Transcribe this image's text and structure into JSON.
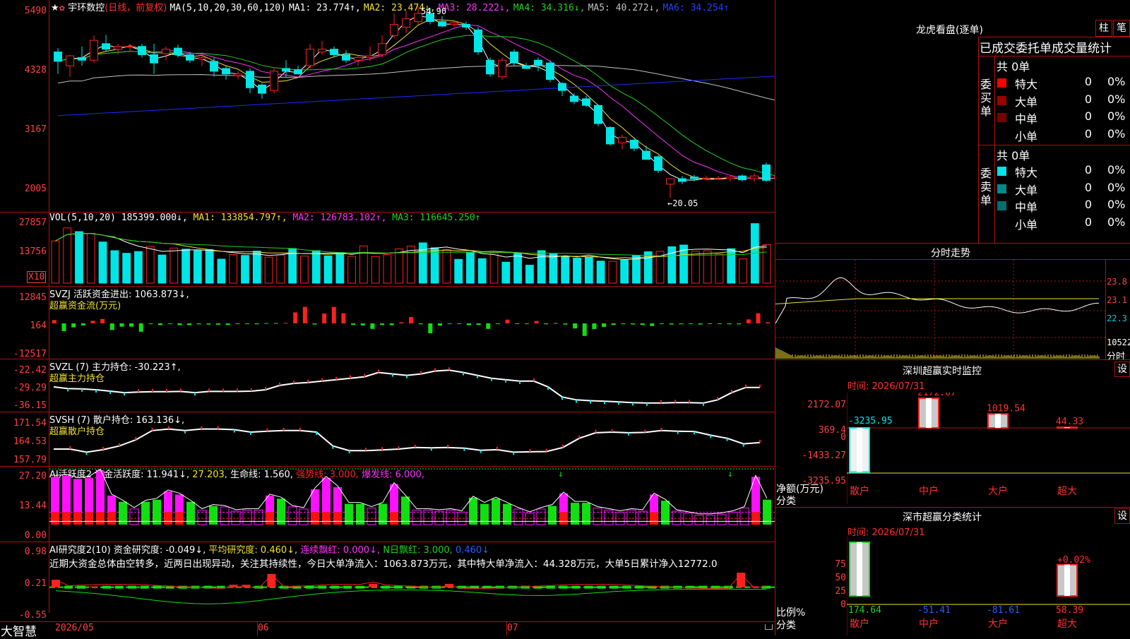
{
  "colors": {
    "up": "#ff2020",
    "down": "#00e5e5",
    "grid": "#b01010",
    "axis": "#ff4040",
    "ma1": "#ffffff",
    "ma2": "#f0e030",
    "ma3": "#ff30ff",
    "ma4": "#20d020",
    "ma5": "#c0c0c0",
    "ma6": "#1a2cff",
    "green": "#10e010",
    "magenta": "#ff10ff"
  },
  "main": {
    "title": "宇环数控",
    "period": "(日线，前复权)",
    "ma_params": "MA(5,10,20,30,60,120)",
    "ma1": "MA1: 23.774↑,",
    "ma2": "MA2: 23.474↓,",
    "ma3": "MA3: 28.222↓,",
    "ma4": "MA4: 34.316↓,",
    "ma5": "MA5: 40.272↓,",
    "ma6": "MA6: 34.254↑",
    "axis": [
      "5490",
      "4328",
      "3167",
      "2005"
    ],
    "high_label": "54.90",
    "low_label": "←20.05"
  },
  "vol": {
    "header": "VOL(5,10,20)",
    "v": "185399.000↓,",
    "ma1": "MA1: 133854.797↑,",
    "ma2": "MA2: 126783.102↑,",
    "ma3": "MA3: 116645.250↑",
    "axis": [
      "27857",
      "13756"
    ],
    "unit": "X10"
  },
  "svzj": {
    "header": "SVZJ  活跃资金进出: 1063.873↓,",
    "sub": "超赢资金流(万元)",
    "axis": [
      "12845",
      "164",
      "-12517"
    ]
  },
  "svzl": {
    "header": "SVZL (7) 主力持仓: -30.223↑,",
    "sub": "超赢主力持仓",
    "axis": [
      "-22.42",
      "-29.29",
      "-36.15"
    ]
  },
  "svsh": {
    "header": "SVSH (7) 散户持仓: 163.136↓,",
    "sub": "超赢散户持仓",
    "axis": [
      "171.54",
      "164.53",
      "157.79"
    ]
  },
  "ai1": {
    "header_a": "AI活跃度2 资金活跃度: 11.941↓,",
    "header_b": "27.203,",
    "header_c": "生命线: 1.560,",
    "header_d": "强势线: 3.000,",
    "header_e": "爆发线: 6.000,",
    "axis": [
      "27.20",
      "13.44",
      "0.00"
    ]
  },
  "ai2": {
    "header_a": "AI研究度2(10) 资金研究度: -0.049↓,",
    "header_b": "平均研究度: 0.460↓,",
    "header_c": "连续飘红: 0.000↓,",
    "header_d": "N日飘红: 3.000,",
    "header_e": "0.460↓",
    "text": "近期大资金总体由空转多，近两日出现异动，关注其持续性，今日大单净流入：1063.873万元，其中特大单净流入：44.328万元，大单5日累计净入12772.0",
    "axis": [
      "0.98",
      "0.21",
      "-0.55"
    ]
  },
  "xaxis": {
    "brand": "大智慧",
    "d1": "2026/05",
    "d2": "06",
    "d3": "07"
  },
  "right": {
    "lhb_title": "龙虎看盘(逐单)",
    "btn_zhu": "柱",
    "btn_bi": "笔",
    "tabs": "已成交委托单成交量统计",
    "buy_label": "委买单",
    "sell_label": "委卖单",
    "buy_total": "共 0单",
    "sell_total": "共 0单",
    "rows": [
      {
        "name": "特大",
        "val": "0",
        "pct": "0%"
      },
      {
        "name": "大单",
        "val": "0",
        "pct": "0%"
      },
      {
        "name": "中单",
        "val": "0",
        "pct": "0%"
      },
      {
        "name": "小单",
        "val": "0",
        "pct": "0%"
      }
    ],
    "fs_title": "分时走势",
    "fs_axis": [
      "23.8",
      "23.1",
      "22.3",
      "10522"
    ],
    "fs_unit": "分时",
    "sz_title": "深圳超赢实时监控",
    "sz_btn": "设",
    "sz_time": "时间: 2026/07/31",
    "sz_axis": [
      "2172.07",
      "369.4",
      "0",
      "-1433.27",
      "-3235.95"
    ],
    "sz_ylabel": "净额(万元)",
    "sz_xlabel": "分类",
    "sz_cats": [
      "散户",
      "中户",
      "大户",
      "超大"
    ],
    "sz_values": [
      "-3235.95",
      "2172.07",
      "1019.54",
      "44.33"
    ],
    "ss_title": "深市超赢分类统计",
    "ss_btn": "设",
    "ss_time": "时间: 2026/07/31",
    "ss_axis": [
      "75",
      "50",
      "25",
      "0"
    ],
    "ss_ylabel": "比例%",
    "ss_xlabel": "分类",
    "ss_cats": [
      "散户",
      "中户",
      "大户",
      "超大"
    ],
    "ss_values": [
      "174.64",
      "-51.41",
      "-81.61",
      "58.39"
    ],
    "ss_pct": "+0.02%"
  },
  "chart_data": [
    {
      "type": "candlestick",
      "title": "宇环数控 (日线，前复权)",
      "ylim": [
        20.05,
        54.9
      ],
      "candles": [
        [
          46.5,
          47.2,
          42.5,
          44.8
        ],
        [
          44.0,
          46.0,
          42.0,
          45.8
        ],
        [
          45.5,
          47.5,
          44.0,
          45.0
        ],
        [
          45.0,
          49.5,
          44.5,
          48.6
        ],
        [
          48.0,
          49.6,
          46.5,
          47.0
        ],
        [
          47.0,
          48.0,
          46.0,
          47.5
        ],
        [
          47.5,
          48.0,
          46.5,
          47.5
        ],
        [
          47.5,
          48.0,
          45.5,
          46.0
        ],
        [
          46.0,
          48.0,
          42.5,
          44.5
        ],
        [
          46.2,
          47.5,
          45.0,
          47.0
        ],
        [
          47.2,
          47.8,
          45.5,
          46.0
        ],
        [
          46.0,
          46.5,
          44.5,
          45.0
        ],
        [
          45.2,
          46.0,
          44.0,
          45.5
        ],
        [
          44.8,
          45.5,
          42.0,
          43.0
        ],
        [
          43.5,
          44.0,
          41.5,
          42.5
        ],
        [
          42.2,
          43.0,
          41.5,
          42.5
        ],
        [
          43.0,
          43.5,
          39.0,
          40.0
        ],
        [
          40.5,
          40.8,
          38.0,
          39.0
        ],
        [
          39.5,
          43.5,
          39.0,
          43.0
        ],
        [
          43.5,
          45.0,
          41.8,
          43.0
        ],
        [
          43.3,
          44.0,
          42.5,
          42.5
        ],
        [
          44.0,
          48.0,
          43.5,
          47.0
        ],
        [
          46.5,
          48.5,
          46.0,
          47.0
        ],
        [
          47.0,
          47.5,
          45.5,
          46.0
        ],
        [
          46.0,
          46.8,
          44.5,
          45.0
        ],
        [
          45.0,
          45.8,
          44.0,
          45.5
        ],
        [
          45.5,
          47.5,
          44.8,
          45.8
        ],
        [
          46.0,
          49.5,
          45.5,
          48.0
        ],
        [
          49.5,
          53.5,
          49.0,
          51.5
        ],
        [
          51.0,
          54.0,
          50.0,
          52.5
        ],
        [
          52.0,
          54.9,
          51.5,
          53.5
        ],
        [
          53.5,
          54.5,
          51.5,
          52.0
        ],
        [
          52.0,
          53.0,
          51.0,
          51.2
        ],
        [
          51.5,
          52.0,
          51.0,
          51.8
        ],
        [
          51.5,
          52.0,
          50.5,
          51.0
        ],
        [
          50.5,
          51.0,
          46.0,
          46.5
        ],
        [
          45.0,
          45.5,
          42.0,
          42.5
        ],
        [
          42.0,
          45.5,
          41.5,
          45.0
        ],
        [
          46.5,
          47.0,
          44.0,
          44.5
        ],
        [
          44.0,
          44.5,
          43.5,
          43.5
        ],
        [
          45.0,
          45.5,
          43.0,
          44.0
        ],
        [
          44.5,
          45.0,
          41.0,
          41.5
        ],
        [
          40.8,
          41.0,
          38.5,
          39.5
        ],
        [
          38.5,
          39.0,
          37.0,
          37.5
        ],
        [
          38.0,
          38.5,
          36.5,
          36.8
        ],
        [
          36.8,
          37.0,
          33.0,
          33.5
        ],
        [
          32.8,
          33.0,
          29.5,
          29.8
        ],
        [
          30.0,
          31.5,
          28.8,
          31.0
        ],
        [
          30.5,
          31.0,
          28.5,
          29.0
        ],
        [
          28.5,
          29.5,
          27.0,
          27.0
        ],
        [
          27.5,
          27.8,
          24.5,
          25.0
        ],
        [
          22.5,
          23.5,
          20.05,
          23.5
        ],
        [
          23.5,
          24.0,
          22.5,
          23.0
        ],
        [
          23.8,
          24.2,
          23.0,
          23.5
        ],
        [
          23.5,
          24.0,
          23.2,
          23.6
        ],
        [
          23.5,
          24.0,
          23.3,
          23.5
        ],
        [
          23.5,
          24.0,
          23.0,
          23.8
        ],
        [
          24.0,
          24.3,
          23.0,
          23.3
        ],
        [
          23.5,
          24.5,
          23.0,
          24.0
        ],
        [
          26.0,
          26.4,
          23.0,
          23.2
        ],
        [
          23.8,
          24.2,
          23.5,
          23.9
        ]
      ]
    },
    {
      "type": "bar",
      "title": "VOL(5,10,20)",
      "values": [
        19500,
        25500,
        23800,
        23000,
        19000,
        15000,
        13800,
        14600,
        17000,
        13000,
        16200,
        15700,
        15000,
        15500,
        11100,
        13200,
        12800,
        14800,
        12000,
        13000,
        16000,
        12500,
        15000,
        12600,
        14000,
        12400,
        17200,
        12300,
        13200,
        15800,
        17100,
        18600,
        16300,
        15500,
        11000,
        14200,
        11300,
        14000,
        9700,
        13900,
        8300,
        15000,
        13600,
        12300,
        11600,
        12200,
        10200,
        10100,
        10600,
        12800,
        14500,
        14700,
        16800,
        17600,
        14700,
        14900,
        13500,
        15900,
        11200,
        27500,
        17800
      ],
      "up": [
        1,
        1,
        0,
        1,
        0,
        0,
        0,
        0,
        1,
        0,
        1,
        0,
        0,
        0,
        0,
        1,
        0,
        0,
        1,
        1,
        0,
        1,
        0,
        0,
        0,
        1,
        1,
        1,
        1,
        1,
        1,
        0,
        0,
        1,
        0,
        0,
        0,
        1,
        0,
        0,
        0,
        0,
        0,
        0,
        0,
        0,
        0,
        1,
        0,
        0,
        0,
        1,
        0,
        0,
        1,
        1,
        1,
        0,
        1,
        0,
        1
      ]
    },
    {
      "type": "bar",
      "title": "超赢资金流(万元)",
      "values": [
        1500,
        -3500,
        -1800,
        -900,
        1200,
        2000,
        -3000,
        -1500,
        -1500,
        -3800,
        -200,
        -800,
        -300,
        -800,
        -800,
        -400,
        -500,
        -600,
        -700,
        -300,
        -200,
        -400,
        0,
        0,
        200,
        5000,
        7500,
        -500,
        4500,
        7500,
        4600,
        -700,
        -900,
        -2500,
        -700,
        -800,
        500,
        2900,
        -400,
        -4500,
        -1000,
        -200,
        -300,
        -800,
        -700,
        -2500,
        -300,
        1700,
        -200,
        -300,
        1100,
        -400,
        0,
        -500,
        -2300,
        -5700,
        -2600,
        -1600,
        -700,
        -200,
        -500,
        -700,
        -1200,
        -300,
        -500,
        -400,
        -200,
        -500,
        -200,
        -300,
        -400,
        -400,
        1800,
        4600,
        500
      ]
    },
    {
      "type": "line",
      "title": "超赢主力持仓",
      "values": [
        -30.0,
        -30.6,
        -30.7,
        -31.0,
        -31.5,
        -32.0,
        -31.8,
        -31.7,
        -31.7,
        -31.6,
        -32.0,
        -31.6,
        -31.6,
        -31.6,
        -31.5,
        -31.0,
        -29.5,
        -28.8,
        -28.5,
        -28.0,
        -27.5,
        -27.0,
        -26.5,
        -25.0,
        -25.5,
        -26.0,
        -25.5,
        -24.5,
        -24.2,
        -25.0,
        -26.0,
        -27.0,
        -27.5,
        -28.0,
        -28.0,
        -30.0,
        -33.5,
        -34.5,
        -34.8,
        -35.0,
        -35.2,
        -35.5,
        -35.6,
        -35.6,
        -35.5,
        -35.5,
        -35.6,
        -34.5,
        -32.0,
        -30.2,
        -30.2
      ]
    },
    {
      "type": "line",
      "title": "超赢散户持仓",
      "values": [
        161.0,
        161.0,
        160.0,
        160.8,
        162.0,
        164.0,
        167.0,
        167.5,
        167.0,
        167.5,
        167.5,
        167.3,
        166.5,
        166.8,
        167.0,
        167.0,
        166.5,
        162.0,
        160.5,
        160.5,
        160.7,
        161.0,
        161.5,
        161.4,
        161.5,
        161.3,
        160.6,
        160.8,
        160.0,
        160.1,
        160.2,
        161.5,
        164.5,
        166.3,
        166.5,
        166.3,
        166.4,
        167.0,
        166.8,
        166.7,
        165.5,
        164.5,
        162.7,
        163.1
      ]
    },
    {
      "type": "bar",
      "title": "AI活跃度2",
      "ylim": [
        0,
        27.2
      ],
      "values": [
        23.0,
        23.5,
        22.0,
        22.5,
        26.0,
        14.0,
        11.0,
        7.5,
        11.0,
        12.0,
        16.0,
        14.5,
        11.0,
        7.0,
        9.0,
        8.5,
        6.5,
        7.0,
        7.0,
        14.0,
        12.5,
        8.5,
        7.5,
        17.0,
        22.5,
        18.0,
        10.0,
        10.0,
        8.0,
        10.0,
        19.5,
        13.5,
        7.0,
        7.0,
        6.5,
        7.0,
        6.0,
        13.0,
        10.0,
        12.5,
        10.0,
        7.5,
        5.5,
        7.5,
        9.0,
        15.0,
        10.5,
        10.5,
        8.0,
        7.0,
        6.0,
        7.0,
        6.5,
        14.5,
        11.5,
        6.5,
        5.5,
        4.5,
        4.5,
        5.0,
        6.0,
        8.0,
        23.0,
        12.0
      ]
    },
    {
      "type": "bar",
      "title": "AI研究度2(10)",
      "ylim": [
        -0.55,
        0.98
      ],
      "values": [
        0.18,
        0.0,
        0.0,
        0.02,
        0.0,
        0.0,
        0.0,
        0.0,
        0.0,
        0.0,
        0.0,
        0.0,
        0.0,
        0.0,
        0.06,
        0.06,
        0.0,
        0.32,
        0.0,
        0.0,
        0.0,
        0.0,
        0.0,
        0.0,
        0.0,
        0.08,
        0.0,
        0.0,
        0.0,
        0.0,
        0.0,
        0.08,
        0.0,
        0.0,
        0.0,
        0.0,
        0.0,
        0.0,
        0.0,
        0.0,
        0.0,
        0.0,
        0.0,
        0.0,
        0.0,
        0.0,
        0.0,
        0.0,
        0.0,
        0.0,
        0.0,
        0.0,
        0.0,
        0.0,
        0.35,
        0.02,
        0.0
      ]
    }
  ]
}
